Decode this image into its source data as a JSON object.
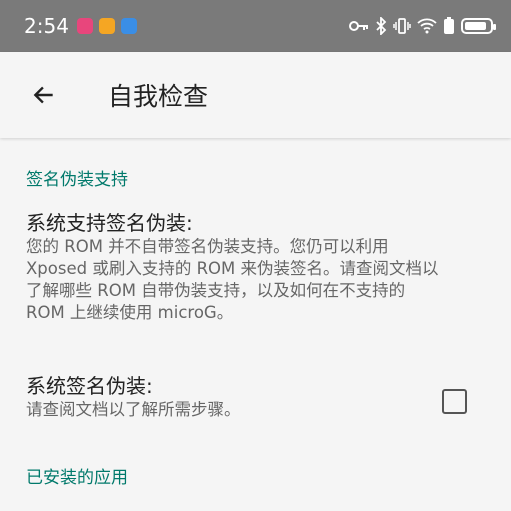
{
  "status_bar": {
    "time": "2:54",
    "icons": [
      "notification-icon-1",
      "notification-icon-2",
      "notification-icon-3",
      "key-icon",
      "bluetooth-icon",
      "vibrate-icon",
      "wifi-icon",
      "battery-saver-icon",
      "battery-icon"
    ]
  },
  "app_bar": {
    "title": "自我检查",
    "back_icon": "arrow-left-icon"
  },
  "sections": {
    "signature": {
      "header": "签名伪装支持",
      "system_support": {
        "title": "系统支持签名伪装:",
        "summary": "您的 ROM 并不自带签名伪装支持。您仍可以利用 Xposed 或刷入支持的 ROM 来伪装签名。请查阅文档以了解哪些 ROM 自带伪装支持，以及如何在不支持的 ROM 上继续使用 microG。"
      },
      "system_spoofing": {
        "title": "系统签名伪装:",
        "summary": "请查阅文档以了解所需步骤。",
        "checked": false
      }
    },
    "installed_apps": {
      "header": "已安装的应用"
    }
  }
}
